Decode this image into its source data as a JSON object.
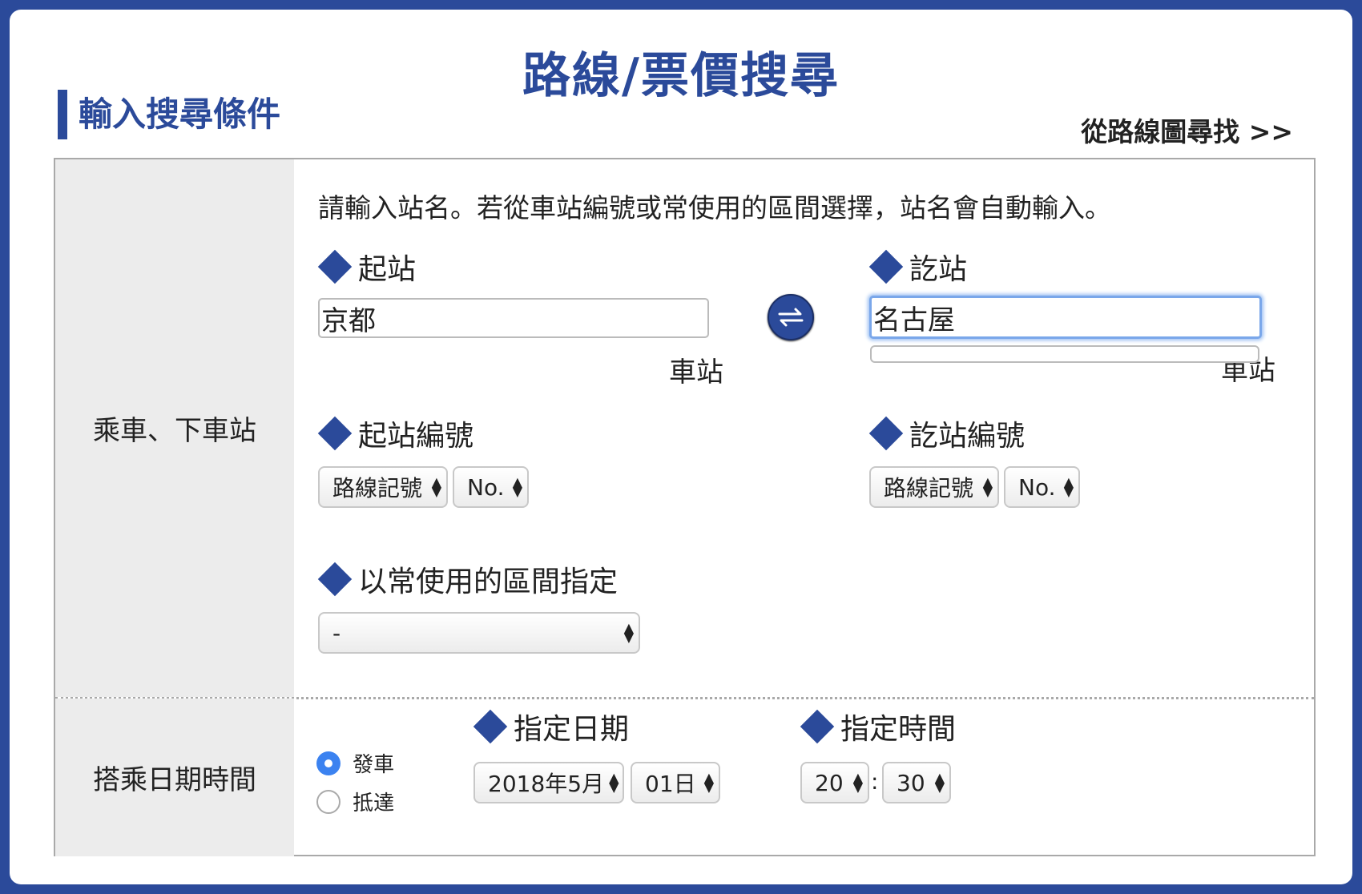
{
  "page_title": "路線/票價搜尋",
  "section_heading": "輸入搜尋條件",
  "map_link": "從路線圖尋找 >>",
  "stations": {
    "row_label": "乘車、下車站",
    "note": "請輸入站名。若從車站編號或常使用的區間選擇，站名會自動輸入。",
    "from_label": "起站",
    "from_value": "京都",
    "from_suffix": "車站",
    "to_label": "訖站",
    "to_value": "名古屋",
    "to_suffix": "車站",
    "swap_icon": "swap-arrows-icon",
    "from_number_label": "起站編號",
    "from_line_select": "路線記號",
    "from_no_select": "No.",
    "to_number_label": "訖站編號",
    "to_line_select": "路線記號",
    "to_no_select": "No.",
    "frequent_label": "以常使用的區間指定",
    "frequent_select": "-"
  },
  "datetime": {
    "row_label": "搭乘日期時間",
    "radio_depart": "發車",
    "radio_arrive": "抵達",
    "selected": "depart",
    "date_label": "指定日期",
    "month_select": "2018年5月",
    "day_select": "01日",
    "time_label": "指定時間",
    "hour_select": "20",
    "separator": ":",
    "minute_select": "30"
  },
  "colors": {
    "brand": "#2b4a9a",
    "focus": "#7aa7ea",
    "radio_selected": "#3b82f0"
  }
}
